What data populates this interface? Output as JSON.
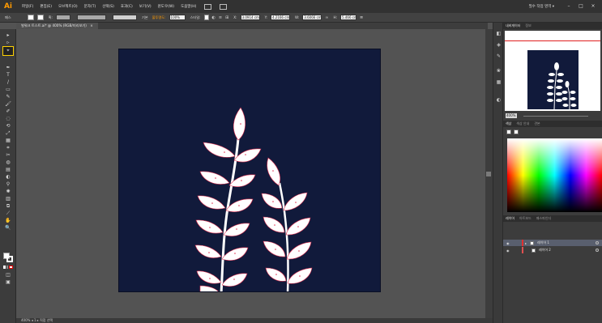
{
  "app": {
    "logo": "Ai"
  },
  "menubar": {
    "items": [
      "파일(F)",
      "편집(E)",
      "오브젝트(O)",
      "문자(T)",
      "선택(S)",
      "효과(C)",
      "보기(V)",
      "윈도우(W)",
      "도움말(H)"
    ],
    "workspace": "필수 작업 영역 ▾",
    "window_controls": [
      "–",
      "□",
      "×"
    ]
  },
  "controlbar": {
    "selection_label": "패스",
    "stroke_label": "획:",
    "style_label": "기본",
    "opacity_label": "불투명도:",
    "opacity_value": "100%",
    "style_text": "스타일:",
    "x_label": "X:",
    "x_value": "3.0914 cm",
    "y_label": "Y:",
    "y_value": "4.2166 cm",
    "w_label": "W:",
    "w_value": "3.6066 cm",
    "h_label": "H:",
    "h_value": "5.466 cm"
  },
  "document": {
    "tab_title": "벌워크 트스트.ai* @ 400% (RGB/미리보기)",
    "tab_close": "×"
  },
  "tools": {
    "selected_tool": "direct-selection-tool",
    "glyphs": [
      "▸",
      "▹",
      "⌖",
      "✒",
      "T",
      "/",
      "▭",
      "✎",
      "🖌",
      "✐",
      "◌",
      "⟲",
      "⤢",
      "▦",
      "⌗",
      "✂",
      "◍",
      "▤",
      "◐",
      "⚲",
      "✋",
      "🔍"
    ]
  },
  "statusbar": {
    "text": "400%  ◂  1  ▸  직접 선택"
  },
  "navigator": {
    "tabs": [
      "내비게이터",
      "정보"
    ],
    "zoom": "400%"
  },
  "color_panel": {
    "tabs": [
      "색상",
      "색상 안내",
      "견본"
    ]
  },
  "layers_panel": {
    "tabs": [
      "레이어",
      "아트보드",
      "패스파인더"
    ],
    "layers": [
      {
        "name": "레이어 1",
        "selected": true
      },
      {
        "name": "레이어 2",
        "selected": false
      }
    ]
  },
  "colors": {
    "artboard": "#111a3b",
    "leaf_fill": "#ffffff",
    "path_outline": "#e03050",
    "selection_highlight": "#ffd200"
  }
}
